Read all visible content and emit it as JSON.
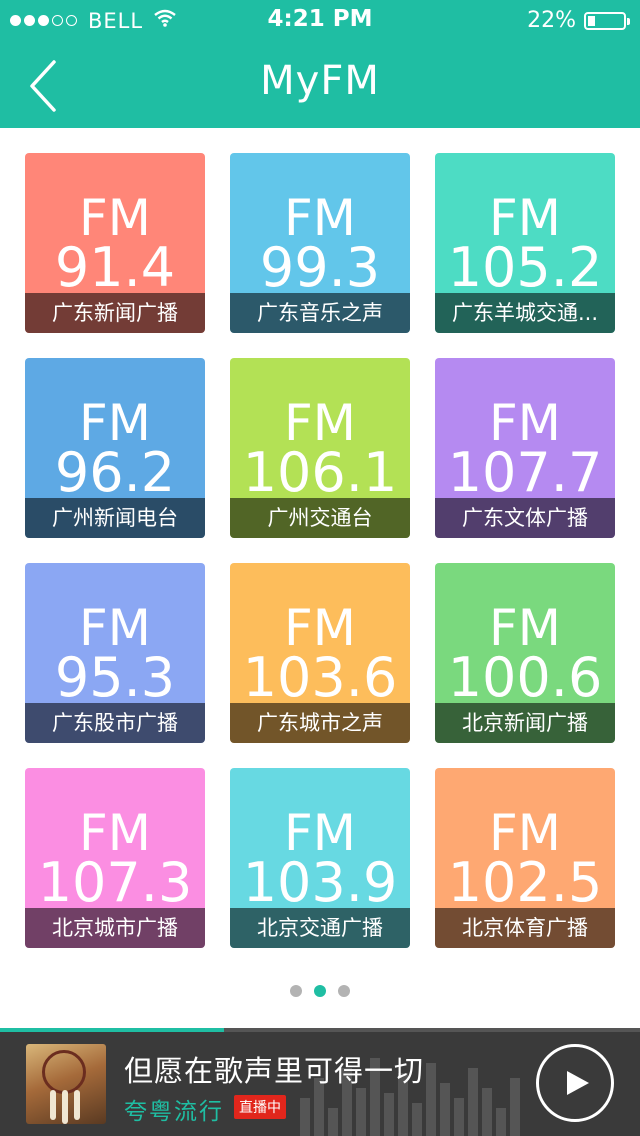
{
  "status_bar": {
    "carrier": "BELL",
    "time": "4:21 PM",
    "battery_text": "22%",
    "battery_level": 0.22,
    "signal_bars_filled": 3,
    "signal_bars_total": 5
  },
  "header": {
    "title": "MyFM",
    "back_icon": "chevron-left-icon",
    "background_color": "#1fbea3"
  },
  "stations": [
    {
      "fm": "FM",
      "frequency": "91.4",
      "name": "广东新闻广播",
      "color": "#ff8678"
    },
    {
      "fm": "FM",
      "frequency": "99.3",
      "name": "广东音乐之声",
      "color": "#62c6ea"
    },
    {
      "fm": "FM",
      "frequency": "105.2",
      "name": "广东羊城交通...",
      "color": "#4ddcc4"
    },
    {
      "fm": "FM",
      "frequency": "96.2",
      "name": "广州新闻电台",
      "color": "#5ea9e4"
    },
    {
      "fm": "FM",
      "frequency": "106.1",
      "name": "广州交通台",
      "color": "#b3e155"
    },
    {
      "fm": "FM",
      "frequency": "107.7",
      "name": "广东文体广播",
      "color": "#b58af1"
    },
    {
      "fm": "FM",
      "frequency": "95.3",
      "name": "广东股市广播",
      "color": "#8ba7f3"
    },
    {
      "fm": "FM",
      "frequency": "103.6",
      "name": "广东城市之声",
      "color": "#fdbd5b"
    },
    {
      "fm": "FM",
      "frequency": "100.6",
      "name": "北京新闻广播",
      "color": "#7ad97e"
    },
    {
      "fm": "FM",
      "frequency": "107.3",
      "name": "北京城市广播",
      "color": "#fb8ee2"
    },
    {
      "fm": "FM",
      "frequency": "103.9",
      "name": "北京交通广播",
      "color": "#67d9e2"
    },
    {
      "fm": "FM",
      "frequency": "102.5",
      "name": "北京体育广播",
      "color": "#fea872"
    }
  ],
  "pager": {
    "pages": 3,
    "active_index": 1,
    "active_color": "#1fbea3"
  },
  "player": {
    "song_title": "但愿在歌声里可得一切",
    "station": "夸粤流行",
    "live_badge": "直播中",
    "progress": 0.35,
    "cover_icon": "album-cover-dreamcatcher",
    "play_icon": "play-icon"
  }
}
